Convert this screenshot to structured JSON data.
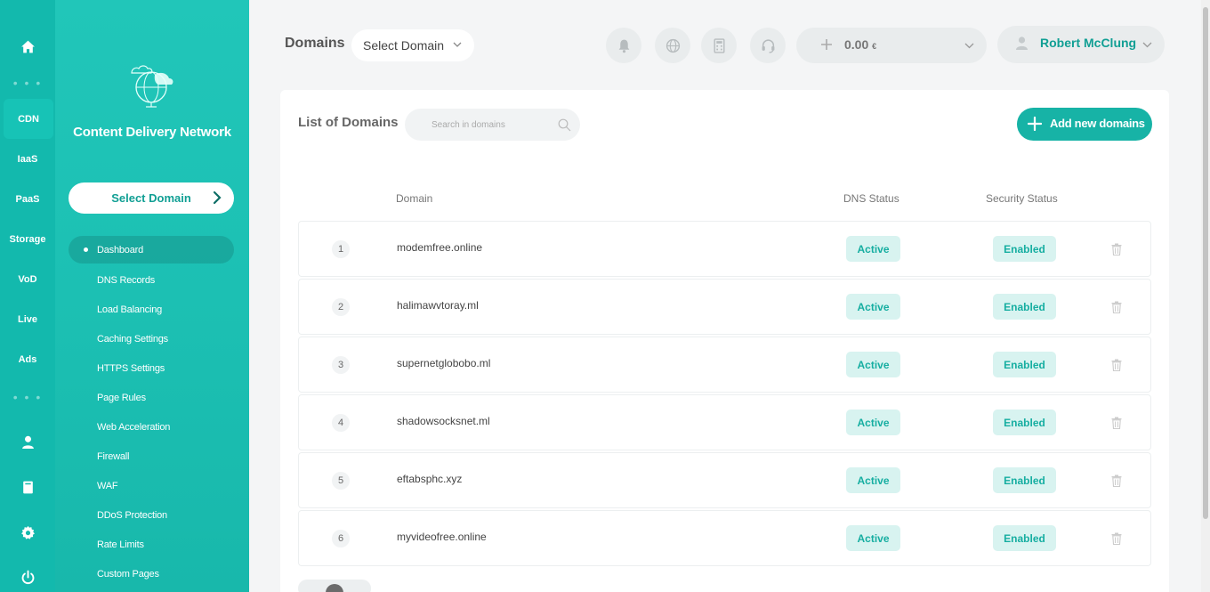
{
  "rail": {
    "items": [
      {
        "label": "CDN"
      },
      {
        "label": "IaaS"
      },
      {
        "label": "PaaS"
      },
      {
        "label": "Storage"
      },
      {
        "label": "VoD"
      },
      {
        "label": "Live"
      },
      {
        "label": "Ads"
      }
    ],
    "dots": "• • •",
    "icons": [
      "home-icon",
      "user-icon",
      "document-icon",
      "gear-icon",
      "power-icon"
    ]
  },
  "sidebar": {
    "title": "Content Delivery Network",
    "select_domain": "Select Domain",
    "menu": [
      {
        "label": "Dashboard"
      },
      {
        "label": "DNS Records"
      },
      {
        "label": "Load Balancing"
      },
      {
        "label": "Caching Settings"
      },
      {
        "label": "HTTPS Settings"
      },
      {
        "label": "Page Rules"
      },
      {
        "label": "Web Acceleration"
      },
      {
        "label": "Firewall"
      },
      {
        "label": "WAF"
      },
      {
        "label": "DDoS Protection"
      },
      {
        "label": "Rate Limits"
      },
      {
        "label": "Custom Pages"
      }
    ]
  },
  "header": {
    "title": "Domains",
    "select_domain": "Select Domain",
    "icons": [
      "bell-icon",
      "globe-icon",
      "calculator-icon",
      "headset-icon"
    ],
    "balance": "0.00",
    "currency": "€",
    "user_name": "Robert McClung"
  },
  "main": {
    "title": "List of Domains",
    "search_placeholder": "Search in domains",
    "add_button": "Add new domains",
    "columns": {
      "domain": "Domain",
      "dns": "DNS Status",
      "security": "Security Status"
    },
    "rows": [
      {
        "num": "1",
        "domain": "modemfree.online",
        "dns": "Active",
        "security": "Enabled"
      },
      {
        "num": "2",
        "domain": "halimawvtoray.ml",
        "dns": "Active",
        "security": "Enabled"
      },
      {
        "num": "3",
        "domain": "supernetglobobo.ml",
        "dns": "Active",
        "security": "Enabled"
      },
      {
        "num": "4",
        "domain": "shadowsocksnet.ml",
        "dns": "Active",
        "security": "Enabled"
      },
      {
        "num": "5",
        "domain": "eftabsphc.xyz",
        "dns": "Active",
        "security": "Enabled"
      },
      {
        "num": "6",
        "domain": "myvideofree.online",
        "dns": "Active",
        "security": "Enabled"
      }
    ]
  },
  "colors": {
    "accent": "#17b3a6",
    "rail": "#13b9ad",
    "sidebar": "#1cc0b3",
    "pill_bg": "#d8f3f0",
    "background": "#f4f5f6"
  }
}
